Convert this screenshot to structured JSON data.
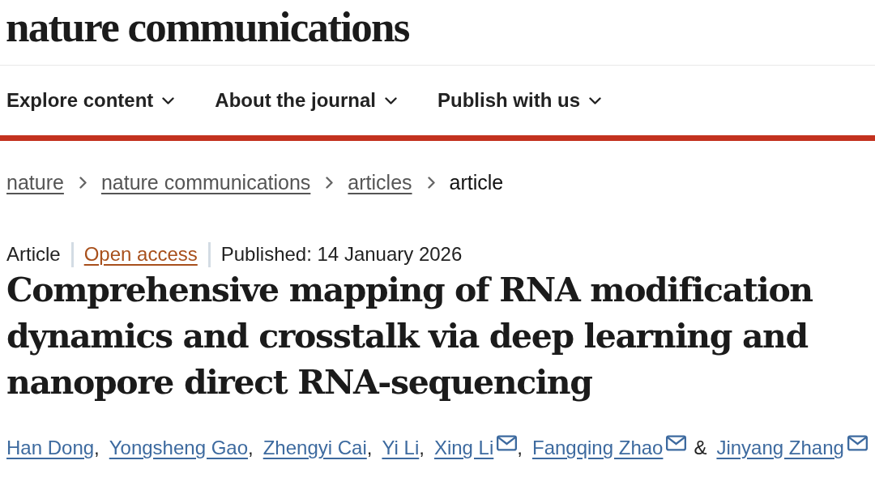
{
  "masthead": {
    "logo": "nature communications"
  },
  "nav": [
    {
      "label": "Explore content",
      "expanded": false
    },
    {
      "label": "About the journal",
      "expanded": false
    },
    {
      "label": "Publish with us",
      "expanded": false
    }
  ],
  "breadcrumb": [
    {
      "label": "nature",
      "kind": "link"
    },
    {
      "label": "nature communications",
      "kind": "link"
    },
    {
      "label": "articles",
      "kind": "link"
    },
    {
      "label": "article",
      "kind": "current"
    }
  ],
  "article": {
    "meta": [
      {
        "text": "Article",
        "kind": "type"
      },
      {
        "text": "Open access",
        "kind": "access"
      },
      {
        "text": "Published: 14 January 2026",
        "kind": "date"
      }
    ],
    "title": "Comprehensive mapping of RNA modification dynamics and crosstalk via deep learning and nanopore direct RNA-sequencing",
    "authors": [
      {
        "name": "Han Dong",
        "email": false,
        "separator": ","
      },
      {
        "name": "Yongsheng Gao",
        "email": false,
        "separator": ","
      },
      {
        "name": "Zhengyi Cai",
        "email": false,
        "separator": ","
      },
      {
        "name": "Yi Li",
        "email": false,
        "separator": ","
      },
      {
        "name": "Xing Li",
        "email": true,
        "separator": ","
      },
      {
        "name": "Fangqing Zhao",
        "email": true,
        "separator": "&"
      },
      {
        "name": "Jinyang Zhang",
        "email": true
      }
    ]
  }
}
